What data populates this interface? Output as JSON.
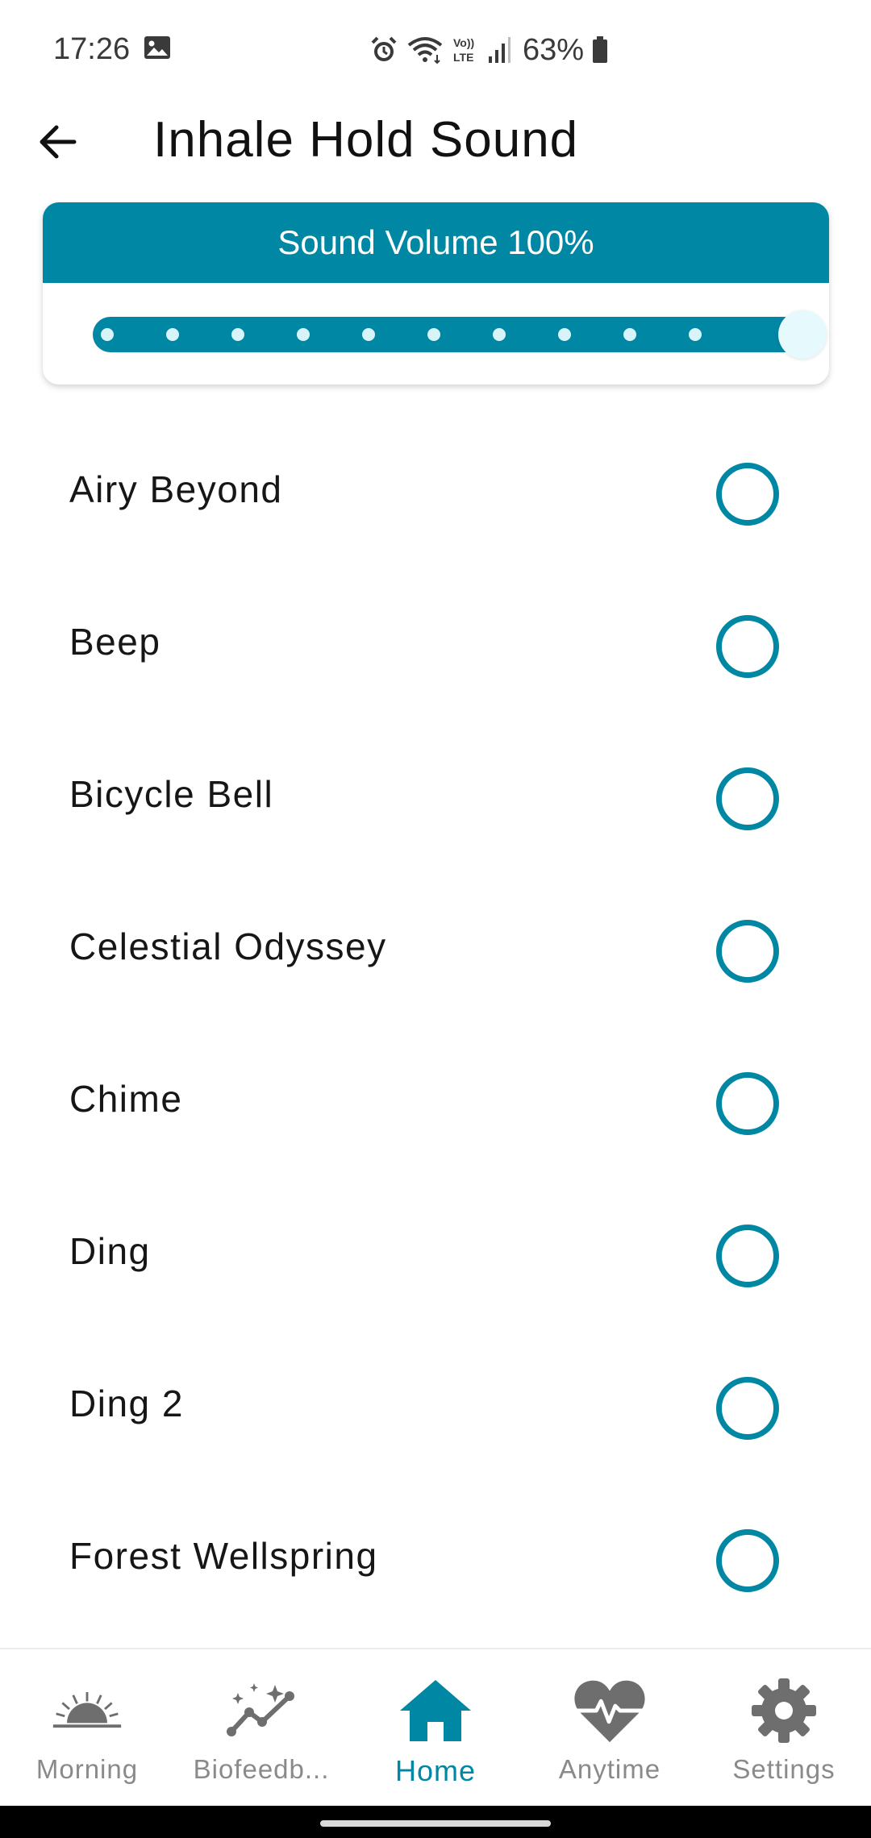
{
  "status_bar": {
    "time": "17:26",
    "battery": "63%",
    "icons": [
      "gallery-icon",
      "alarm-icon",
      "wifi-icon",
      "volte-icon",
      "signal-icon",
      "battery-icon"
    ]
  },
  "header": {
    "back_icon": "arrow-left-icon",
    "title": "Inhale Hold Sound"
  },
  "volume": {
    "label": "Sound Volume 100%",
    "value_percent": 100,
    "tick_count": 10,
    "accent_color": "#0087a3"
  },
  "sounds": [
    {
      "label": "Airy Beyond",
      "selected": false
    },
    {
      "label": "Beep",
      "selected": false
    },
    {
      "label": "Bicycle Bell",
      "selected": false
    },
    {
      "label": "Celestial Odyssey",
      "selected": false
    },
    {
      "label": "Chime",
      "selected": false
    },
    {
      "label": "Ding",
      "selected": false
    },
    {
      "label": "Ding 2",
      "selected": false
    },
    {
      "label": "Forest Wellspring",
      "selected": false
    }
  ],
  "nav": {
    "items": [
      {
        "label": "Morning",
        "icon": "sunrise-icon",
        "active": false
      },
      {
        "label": "Biofeedb...",
        "icon": "sparkle-chart-icon",
        "active": false
      },
      {
        "label": "Home",
        "icon": "home-icon",
        "active": true
      },
      {
        "label": "Anytime",
        "icon": "heart-pulse-icon",
        "active": false
      },
      {
        "label": "Settings",
        "icon": "gear-icon",
        "active": false
      }
    ]
  },
  "colors": {
    "accent": "#0087a3",
    "inactive_nav": "#8a8a8a",
    "icon_gray": "#6e6e6e"
  }
}
